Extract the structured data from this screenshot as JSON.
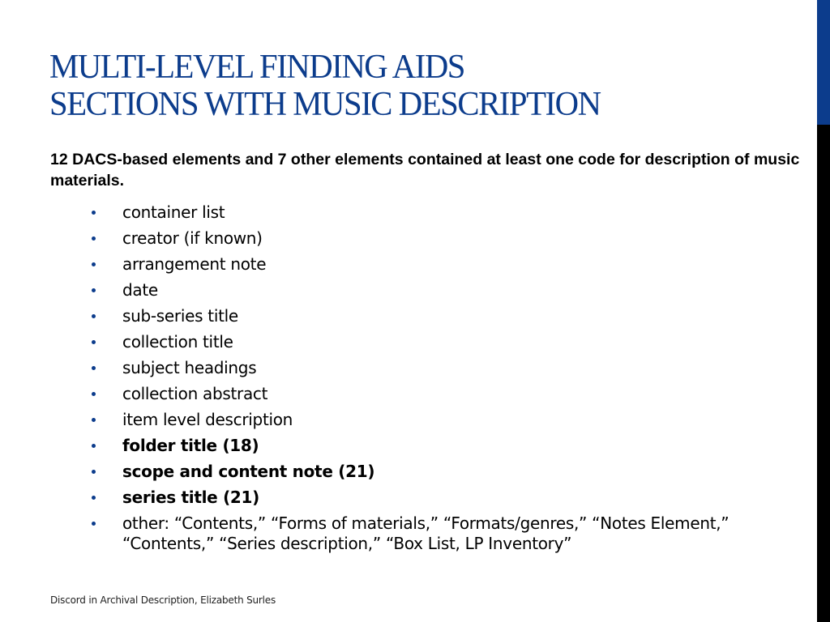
{
  "slide": {
    "title_lines": [
      "MULTI-LEVEL FINDING AIDS",
      "SECTIONS WITH MUSIC DESCRIPTION"
    ],
    "intro": "12 DACS-based elements and 7 other elements contained at least one code for description of music materials.",
    "bullets": [
      {
        "text": "container list",
        "bold": false
      },
      {
        "text": "creator (if known)",
        "bold": false
      },
      {
        "text": "arrangement note",
        "bold": false
      },
      {
        "text": "date",
        "bold": false
      },
      {
        "text": "sub-series title",
        "bold": false
      },
      {
        "text": "collection title",
        "bold": false
      },
      {
        "text": "subject headings",
        "bold": false
      },
      {
        "text": "collection abstract",
        "bold": false
      },
      {
        "text": "item level description",
        "bold": false
      },
      {
        "text": "folder title (18)",
        "bold": true
      },
      {
        "text": "scope and content note (21)",
        "bold": true
      },
      {
        "text": "series title (21)",
        "bold": true
      },
      {
        "text": "other: “Contents,” “Forms of materials,” “Formats/genres,” “Notes Element,” “Contents,” “Series description,” “Box List, LP Inventory”",
        "bold": false
      }
    ],
    "footer": "Discord in Archival Description, Elizabeth Surles"
  },
  "colors": {
    "accent_blue": "#0c3c8c",
    "side_bar_lower": "#000000",
    "text": "#000000"
  }
}
